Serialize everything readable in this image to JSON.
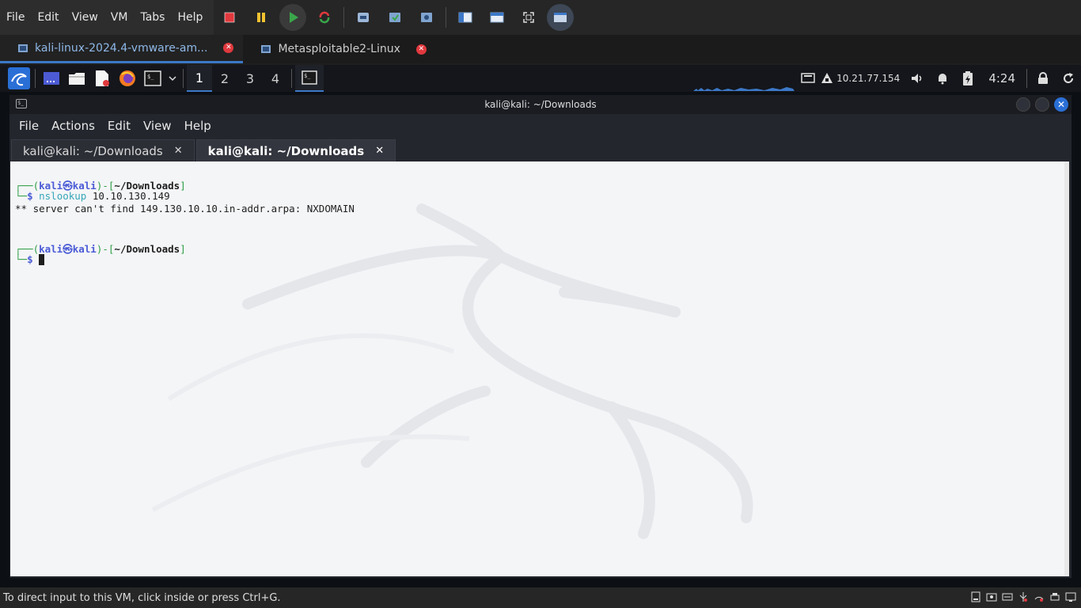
{
  "vmware": {
    "menus": [
      "File",
      "Edit",
      "View",
      "VM",
      "Tabs",
      "Help"
    ],
    "tabs": [
      {
        "label": "kali-linux-2024.4-vmware-am..."
      },
      {
        "label": "Metasploitable2-Linux"
      }
    ],
    "status_text": "To direct input to this VM, click inside or press Ctrl+G."
  },
  "kali_panel": {
    "workspaces": [
      "1",
      "2",
      "3",
      "4"
    ],
    "ip": "10.21.77.154",
    "clock": "4:24"
  },
  "terminal": {
    "title": "kali@kali: ~/Downloads",
    "menu": [
      "File",
      "Actions",
      "Edit",
      "View",
      "Help"
    ],
    "tabs": [
      {
        "label": "kali@kali: ~/Downloads"
      },
      {
        "label": "kali@kali: ~/Downloads"
      }
    ],
    "prompt": {
      "user": "kali",
      "at": "㉿",
      "host": "kali",
      "path": "~/Downloads"
    },
    "command": "nslookup",
    "command_arg": "10.10.130.149",
    "output": "** server can't find 149.130.10.10.in-addr.arpa: NXDOMAIN"
  },
  "colors": {
    "accent_blue": "#3c78c8",
    "prompt_green": "#2e9f46",
    "prompt_user": "#4a5bd6",
    "command_cyan": "#36a6b8",
    "close_red": "#e0393e"
  }
}
